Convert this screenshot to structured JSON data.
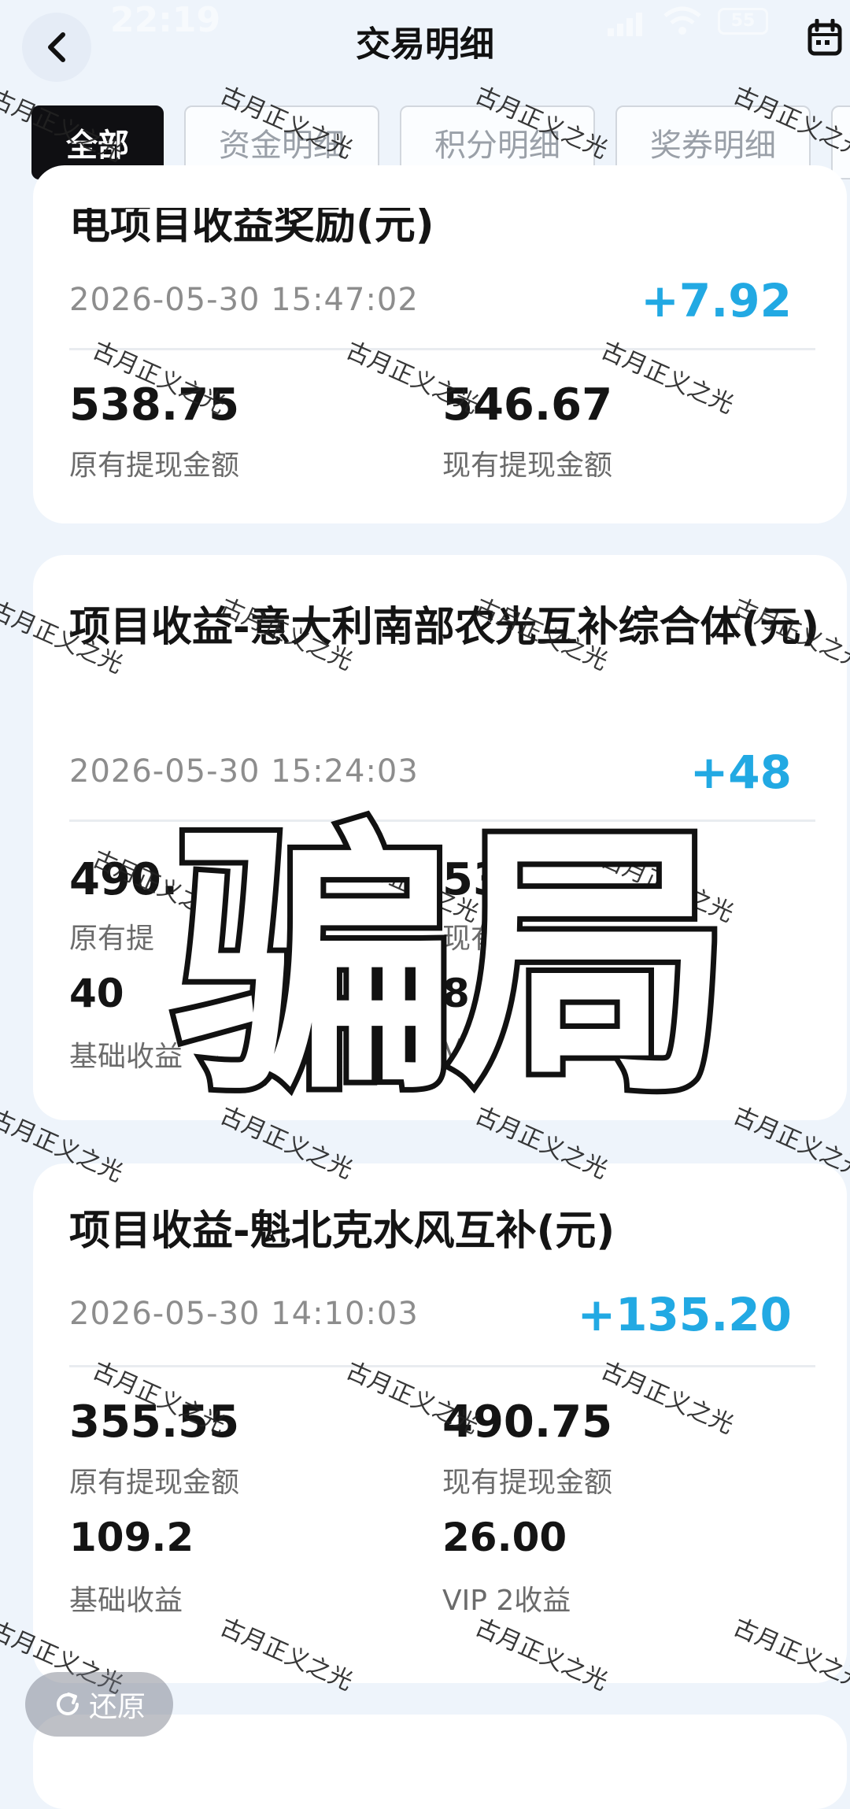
{
  "status_bar": {
    "time": "22:19",
    "battery": "55"
  },
  "header": {
    "title": "交易明细"
  },
  "tabs": [
    {
      "label": "全部",
      "active": true
    },
    {
      "label": "资金明细",
      "active": false
    },
    {
      "label": "积分明细",
      "active": false
    },
    {
      "label": "奖券明细",
      "active": false
    }
  ],
  "cards": [
    {
      "title": "电项目收益奖励(元)",
      "datetime": "2026-05-30 15:47:02",
      "amount": "+7.92",
      "original_value": "538.75",
      "original_label": "原有提现金额",
      "current_value": "546.67",
      "current_label": "现有提现金额"
    },
    {
      "title": "项目收益-意大利南部农光互补综合体(元)",
      "datetime": "2026-05-30 15:24:03",
      "amount": "+48",
      "original_value": "490.",
      "original_label": "原有提",
      "current_value": "53",
      "current_label": "现有",
      "base_value": "40",
      "base_label": "基础收益",
      "vip_value": "8.0",
      "vip_label": "V"
    },
    {
      "title": "项目收益-魁北克水风互补(元)",
      "datetime": "2026-05-30 14:10:03",
      "amount": "+135.20",
      "original_value": "355.55",
      "original_label": "原有提现金额",
      "current_value": "490.75",
      "current_label": "现有提现金额",
      "base_value": "109.2",
      "base_label": "基础收益",
      "vip_value": "26.00",
      "vip_label": "VIP 2收益"
    }
  ],
  "overlay": {
    "text": "骗局"
  },
  "watermark": {
    "text": "古月正义之光"
  },
  "restore_button": {
    "label": "还原"
  },
  "colors": {
    "amount": "#22a9e3",
    "active_tab": "#0f0f12",
    "background": "#eef4fb"
  }
}
